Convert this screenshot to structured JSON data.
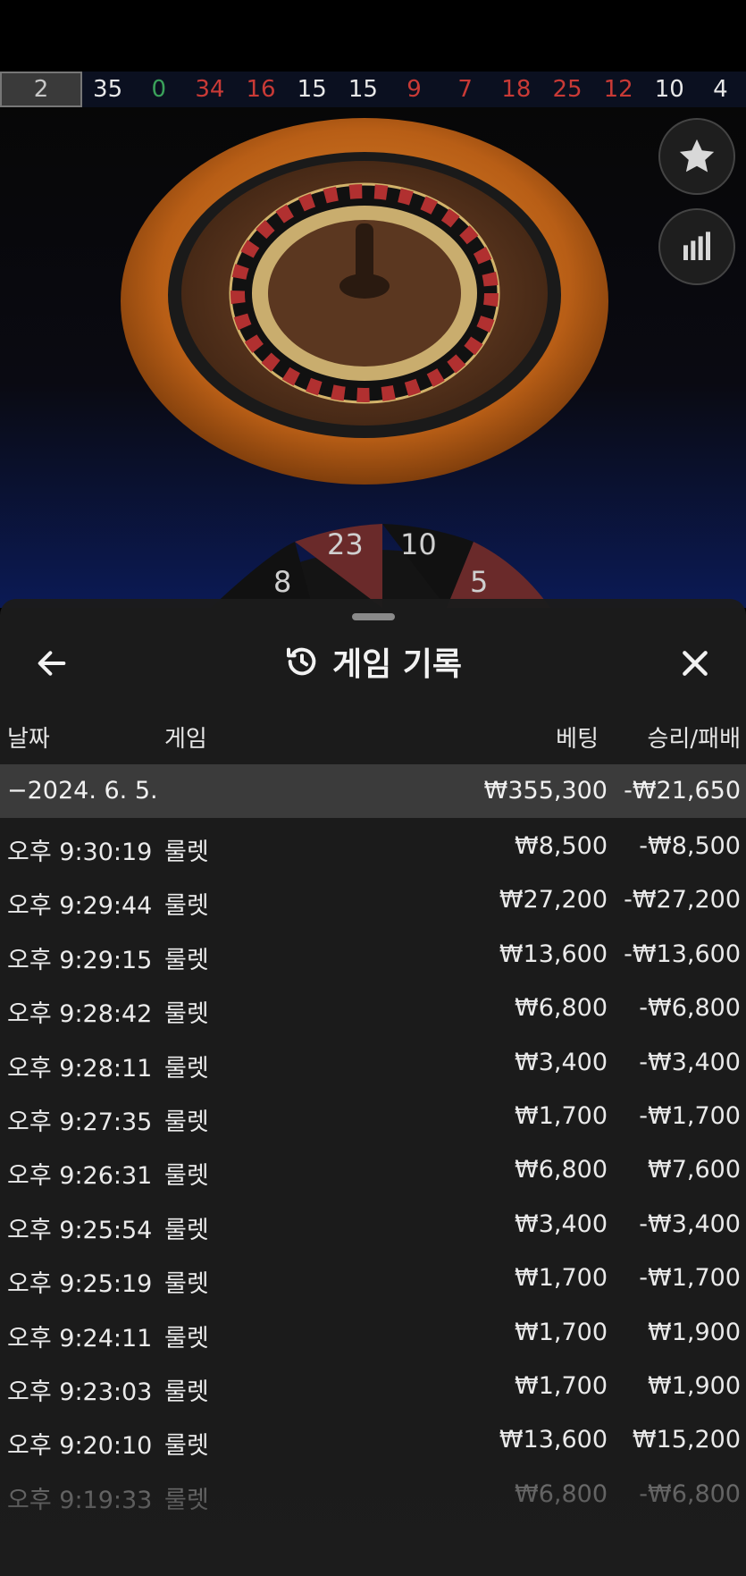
{
  "results_strip": [
    {
      "value": "2",
      "color": "black"
    },
    {
      "value": "35",
      "color": "black"
    },
    {
      "value": "0",
      "color": "green"
    },
    {
      "value": "34",
      "color": "red"
    },
    {
      "value": "16",
      "color": "red"
    },
    {
      "value": "15",
      "color": "black"
    },
    {
      "value": "15",
      "color": "black"
    },
    {
      "value": "9",
      "color": "red"
    },
    {
      "value": "7",
      "color": "red"
    },
    {
      "value": "18",
      "color": "red"
    },
    {
      "value": "25",
      "color": "red"
    },
    {
      "value": "12",
      "color": "red"
    },
    {
      "value": "10",
      "color": "black"
    },
    {
      "value": "4",
      "color": "black"
    }
  ],
  "side_buttons": {
    "favorite_icon": "star-icon",
    "stats_icon": "bar-chart-icon"
  },
  "racetrack_peek": [
    "8",
    "23",
    "10",
    "5"
  ],
  "history": {
    "title": "게임 기록",
    "columns": {
      "date": "날짜",
      "game": "게임",
      "bet": "베팅",
      "result": "승리/패배"
    },
    "date_group": {
      "label": "−2024. 6. 5.",
      "bet_total": "₩355,300",
      "result_total": "-₩21,650"
    },
    "rows": [
      {
        "time": "오후 9:30:19",
        "game": "룰렛",
        "bet": "₩8,500",
        "result": "-₩8,500"
      },
      {
        "time": "오후 9:29:44",
        "game": "룰렛",
        "bet": "₩27,200",
        "result": "-₩27,200"
      },
      {
        "time": "오후 9:29:15",
        "game": "룰렛",
        "bet": "₩13,600",
        "result": "-₩13,600"
      },
      {
        "time": "오후 9:28:42",
        "game": "룰렛",
        "bet": "₩6,800",
        "result": "-₩6,800"
      },
      {
        "time": "오후 9:28:11",
        "game": "룰렛",
        "bet": "₩3,400",
        "result": "-₩3,400"
      },
      {
        "time": "오후 9:27:35",
        "game": "룰렛",
        "bet": "₩1,700",
        "result": "-₩1,700"
      },
      {
        "time": "오후 9:26:31",
        "game": "룰렛",
        "bet": "₩6,800",
        "result": "₩7,600"
      },
      {
        "time": "오후 9:25:54",
        "game": "룰렛",
        "bet": "₩3,400",
        "result": "-₩3,400"
      },
      {
        "time": "오후 9:25:19",
        "game": "룰렛",
        "bet": "₩1,700",
        "result": "-₩1,700"
      },
      {
        "time": "오후 9:24:11",
        "game": "룰렛",
        "bet": "₩1,700",
        "result": "₩1,900"
      },
      {
        "time": "오후 9:23:03",
        "game": "룰렛",
        "bet": "₩1,700",
        "result": "₩1,900"
      },
      {
        "time": "오후 9:20:10",
        "game": "룰렛",
        "bet": "₩13,600",
        "result": "₩15,200"
      },
      {
        "time": "오후 9:19:33",
        "game": "룰렛",
        "bet": "₩6,800",
        "result": "-₩6,800"
      }
    ]
  },
  "colors": {
    "red": "#c93a36",
    "black": "#e8e8e8",
    "green": "#3aa15a",
    "sheet_bg": "#1c1c1c",
    "date_row_bg": "#3b3b3b"
  }
}
